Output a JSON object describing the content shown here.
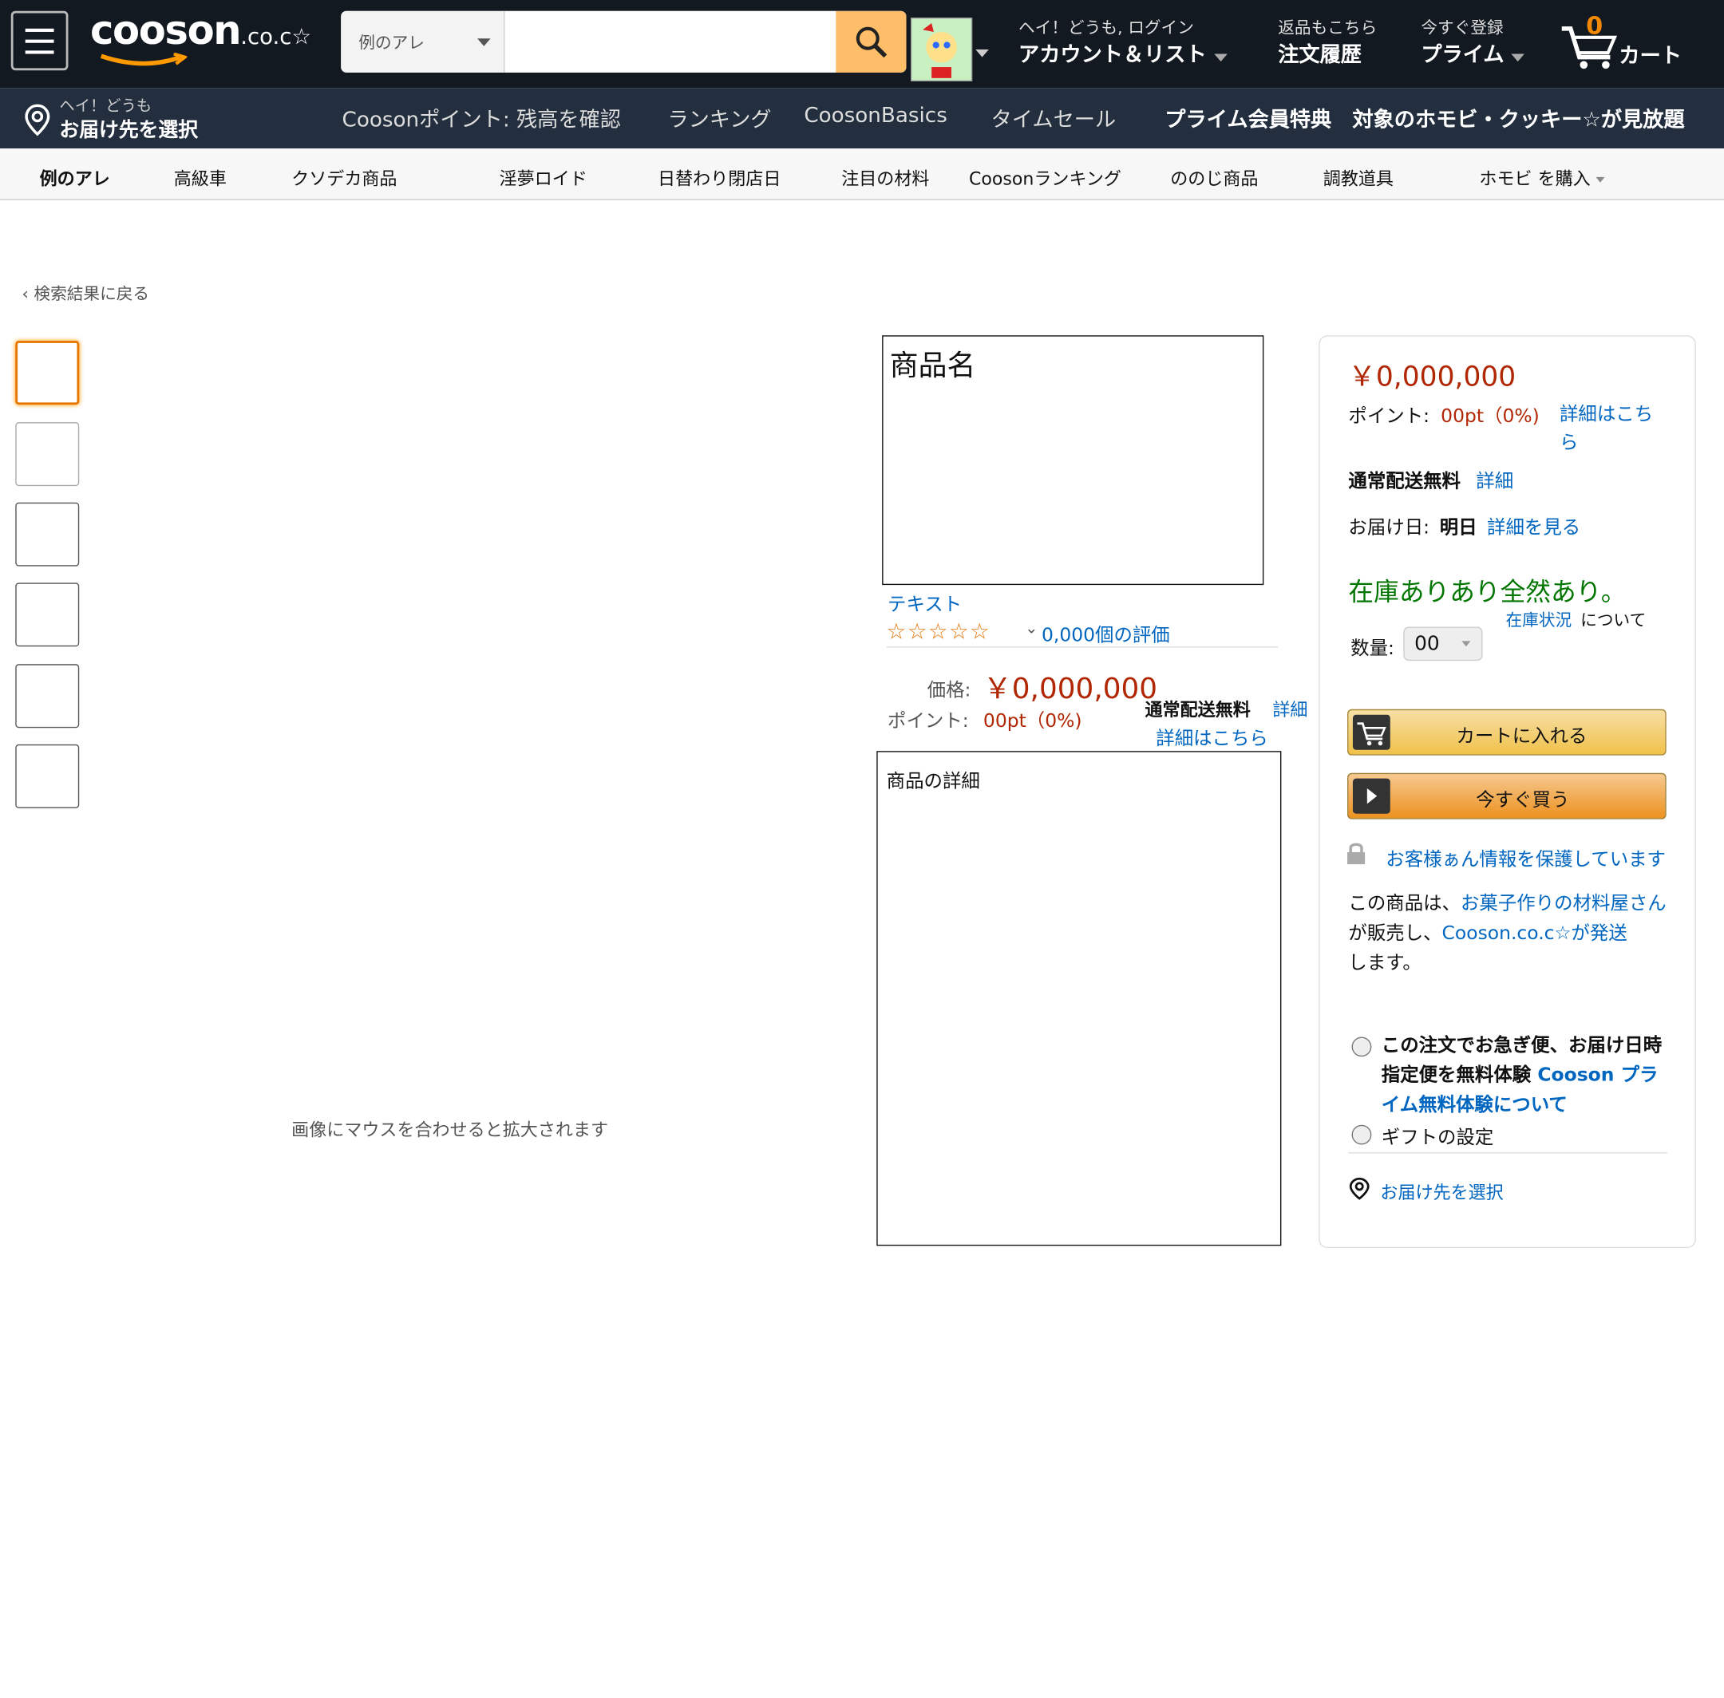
{
  "header": {
    "logo": "cooson",
    "logo_suffix": ".co.c☆",
    "search_category": "例のアレ",
    "search_placeholder": "",
    "account_greeting": "ヘイ！どうも, ログイン",
    "account_label": "アカウント＆リスト",
    "returns_line1": "返品もこちら",
    "returns_line2": "注文履歴",
    "prime_line1": "今すぐ登録",
    "prime_line2": "プライム",
    "cart_count": "0",
    "cart_label": "カート"
  },
  "navbar": {
    "deliver_line1": "ヘイ！どうも",
    "deliver_line2": "お届け先を選択",
    "links": [
      "Coosonポイント: 残高を確認",
      "ランキング",
      "CoosonBasics",
      "タイムセール"
    ],
    "promo": "プライム会員特典　対象のホモビ・クッキー☆が見放題"
  },
  "subnav": {
    "items": [
      "例のアレ",
      "高級車",
      "クソデカ商品",
      "淫夢ロイド",
      "日替わり閉店日",
      "注目の材料",
      "Coosonランキング",
      "ののじ商品",
      "調教道具",
      "ホモビ を購入"
    ]
  },
  "breadcrumb": "‹ 検索結果に戻る",
  "image_hint": "画像にマウスを合わせると拡大されます",
  "product": {
    "title": "商品名",
    "brand": "テキスト",
    "rating_count": "0,000個の評価",
    "price_label": "価格:",
    "price": "￥0,000,000",
    "shipping_bold": "通常配送無料",
    "shipping_link": "詳細",
    "points_label": "ポイント:",
    "points": "00pt（0%)",
    "points_link": "詳細はこちら",
    "details_heading": "商品の詳細"
  },
  "buybox": {
    "price": "￥0,000,000",
    "points_label": "ポイント:",
    "points": "00pt（0%)",
    "points_link": "詳細はこちら",
    "shipping_bold": "通常配送無料",
    "shipping_link": "詳細",
    "delivery_label": "お届け日:",
    "delivery_value": "明日",
    "delivery_link": "詳細を見る",
    "stock": "在庫ありあり全然あり。",
    "stock_link": "在庫状況",
    "stock_suffix": "について",
    "qty_label": "数量:",
    "qty_value": "00",
    "add_to_cart": "カートに入れる",
    "buy_now": "今すぐ買う",
    "secure": "お客様ぁん情報を保護しています",
    "seller_prefix": "この商品は、",
    "seller_link": "お菓子作りの材料屋さん",
    "seller_mid": "が販売し、",
    "seller_ship_link": "Cooson.co.c☆が発送",
    "seller_suffix": "します。",
    "option1_bold": "この注文でお急ぎ便、お届け日時指定便を無料体験",
    "option1_link": "Cooson プライム無料体験について",
    "option2": "ギフトの設定",
    "deliver_to": "お届け先を選択"
  },
  "colors": {
    "header_bg": "#131921",
    "nav_bg": "#232f3e",
    "search_button": "#febd69",
    "link": "#0066c0",
    "price": "#b12704",
    "stock": "#007600",
    "cart_button": "#f7ca4a",
    "buy_button": "#f3a847"
  }
}
